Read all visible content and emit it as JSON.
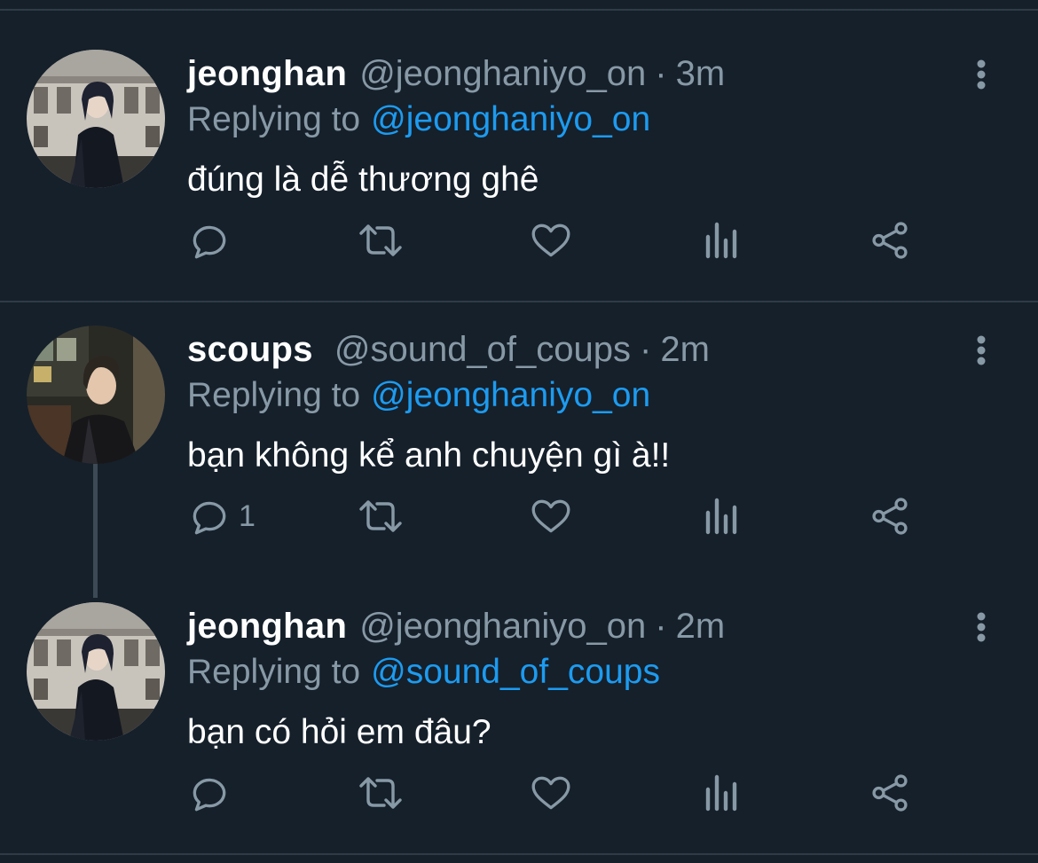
{
  "colors": {
    "background": "#15202b",
    "divider": "#2f3b47",
    "name": "#ffffff",
    "muted": "#8899a6",
    "link": "#1d9bf0",
    "icon": "#8899a6"
  },
  "replying_prefix": "Replying to",
  "icons": [
    "more-icon",
    "reply-icon",
    "retweet-icon",
    "like-icon",
    "analytics-icon",
    "share-icon"
  ],
  "tweets": [
    {
      "name": "jeonghan",
      "handle": "@jeonghaniyo_on",
      "separator": "·",
      "time": "3m",
      "replying_to": "@jeonghaniyo_on",
      "text": "đúng là dễ thương ghê",
      "reply_count": ""
    },
    {
      "name": "scoups",
      "handle": "@sound_of_coups",
      "separator": "·",
      "time": "2m",
      "replying_to": "@jeonghaniyo_on",
      "text": "bạn không kể anh chuyện gì à!!",
      "reply_count": "1"
    },
    {
      "name": "jeonghan",
      "handle": "@jeonghaniyo_on",
      "separator": "·",
      "time": "2m",
      "replying_to": "@sound_of_coups",
      "text": "bạn có hỏi em đâu?",
      "reply_count": ""
    }
  ]
}
